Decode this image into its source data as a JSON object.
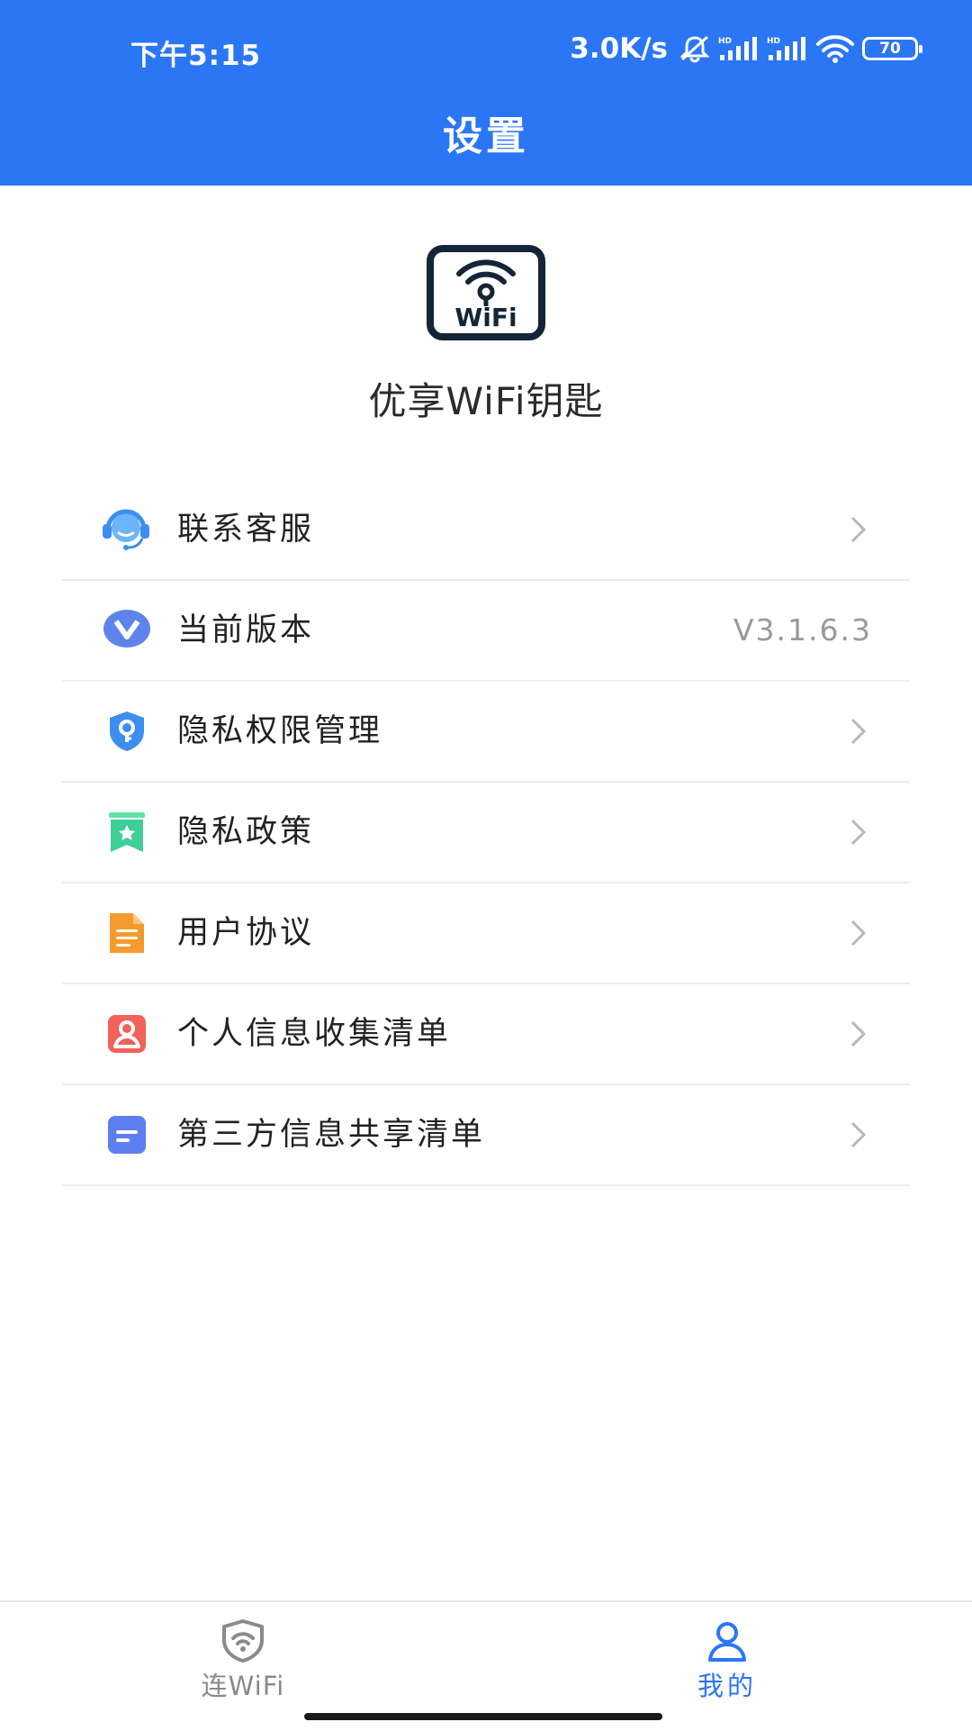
{
  "status_bar": {
    "time": "下午5:15",
    "net_speed": "3.0K/s",
    "battery": "70"
  },
  "header": {
    "title": "设置"
  },
  "app": {
    "name": "优享WiFi钥匙",
    "logo_text": "WiFi"
  },
  "menu": {
    "items": [
      {
        "label": "联系客服",
        "icon": "customer-service-icon",
        "color": "#4a9af5"
      },
      {
        "label": "当前版本",
        "icon": "version-icon",
        "value": "V3.1.6.3",
        "color": "#4f7de8"
      },
      {
        "label": "隐私权限管理",
        "icon": "shield-key-icon",
        "color": "#3d8ef0"
      },
      {
        "label": "隐私政策",
        "icon": "bookmark-star-icon",
        "color": "#3ecf95"
      },
      {
        "label": "用户协议",
        "icon": "document-icon",
        "color": "#f59a2c"
      },
      {
        "label": "个人信息收集清单",
        "icon": "person-card-icon",
        "color": "#f0625a"
      },
      {
        "label": "第三方信息共享清单",
        "icon": "list-doc-icon",
        "color": "#5b7ef0"
      }
    ]
  },
  "tabbar": {
    "tabs": [
      {
        "label": "连WiFi",
        "icon": "wifi-shield-icon",
        "active": false
      },
      {
        "label": "我的",
        "icon": "user-icon",
        "active": true
      }
    ]
  },
  "colors": {
    "accent": "#2a76f5",
    "divider": "#ececec"
  }
}
